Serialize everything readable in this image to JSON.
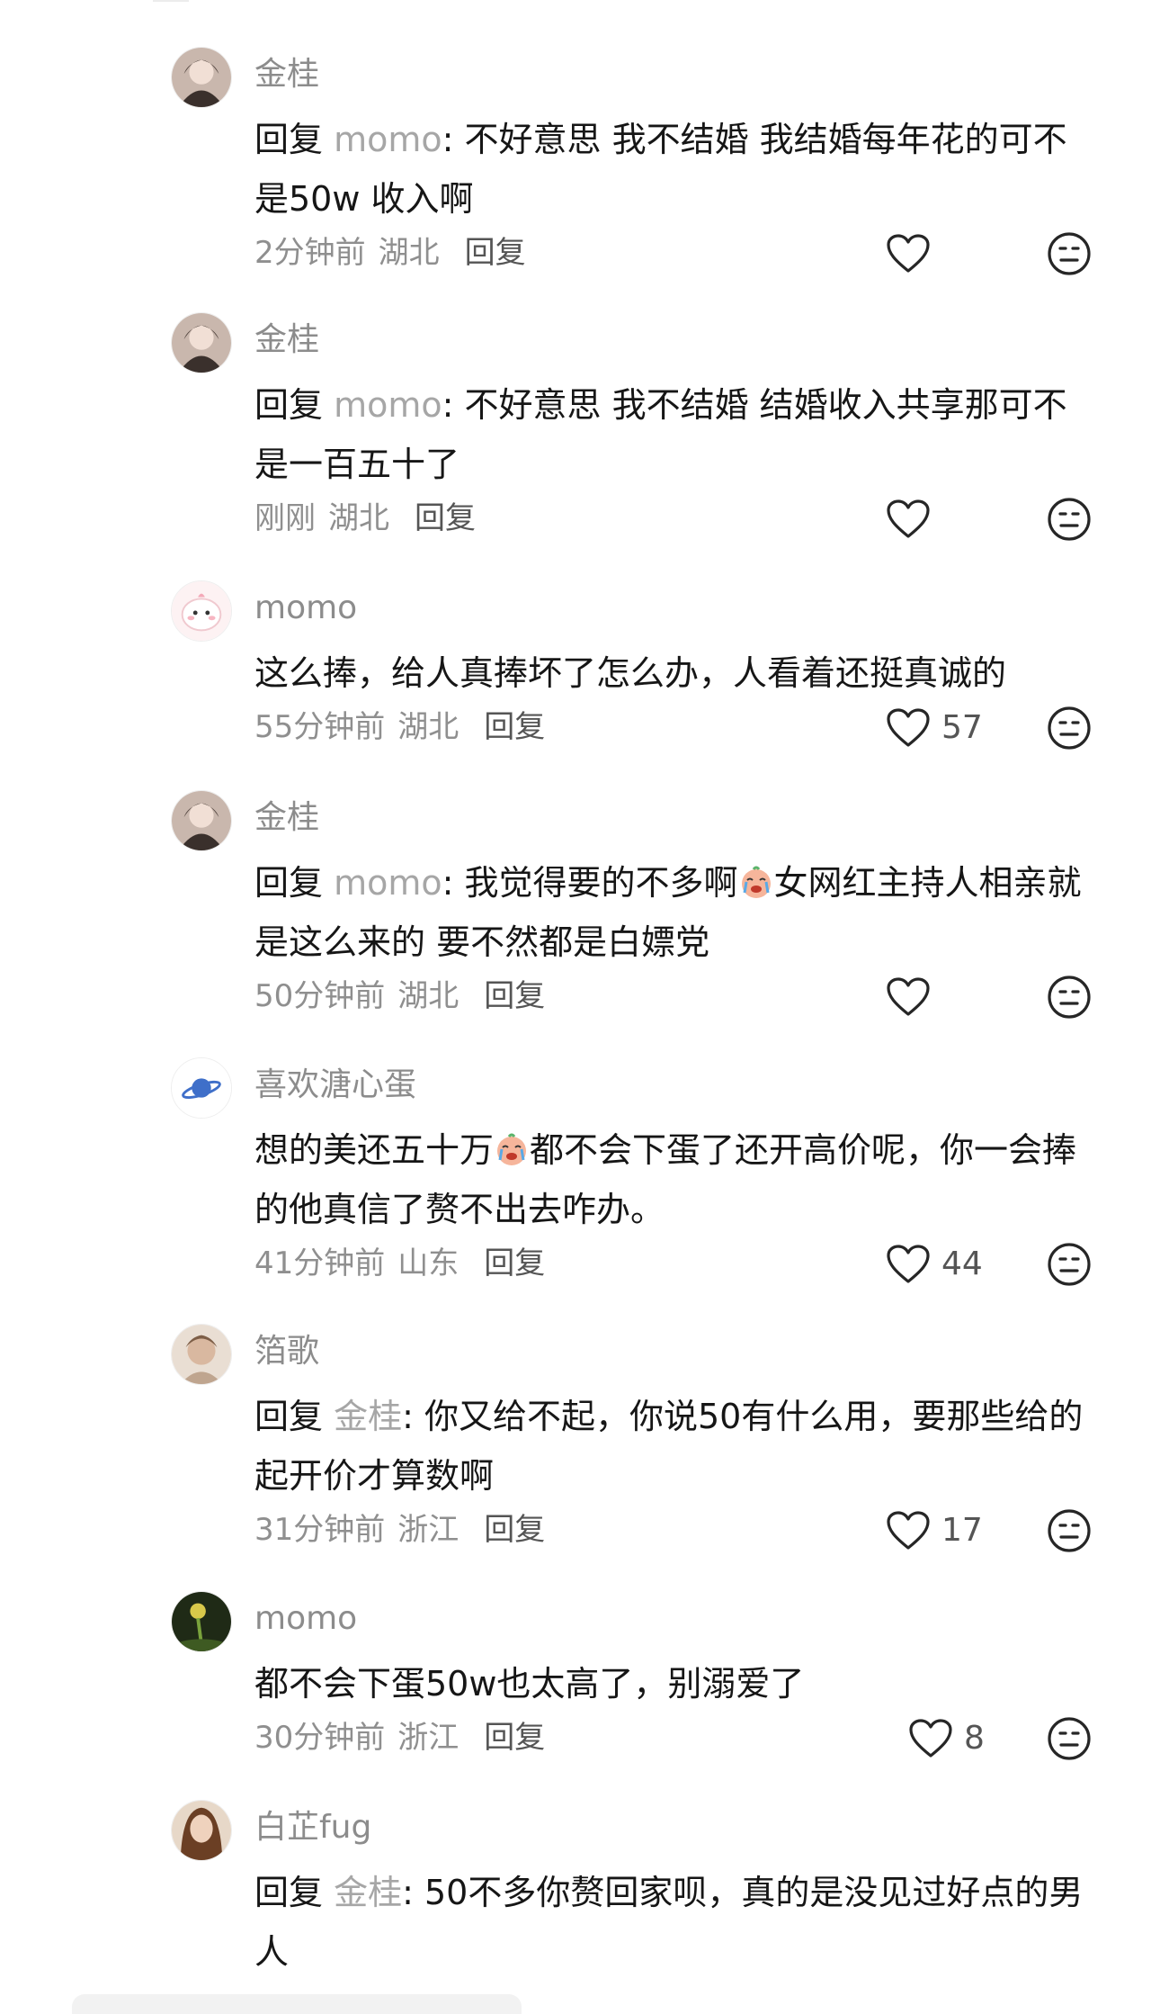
{
  "comments": [
    {
      "username": "金桂",
      "reply_prefix": "回复 ",
      "reply_target": "momo",
      "text": ": 不好意思 我不结婚 我结婚每年花的可不是50w 收入啊",
      "time": "2分钟前",
      "location": "湖北",
      "reply_label": "回复",
      "like_count": ""
    },
    {
      "username": "金桂",
      "reply_prefix": "回复 ",
      "reply_target": "momo",
      "text": ": 不好意思 我不结婚 结婚收入共享那可不是一百五十了",
      "time": "刚刚",
      "location": "湖北",
      "reply_label": "回复",
      "like_count": ""
    },
    {
      "username": "momo",
      "text": "这么捧，给人真捧坏了怎么办，人看着还挺真诚的",
      "time": "55分钟前",
      "location": "湖北",
      "reply_label": "回复",
      "like_count": "57"
    },
    {
      "username": "金桂",
      "reply_prefix": "回复 ",
      "reply_target": "momo",
      "text_before_emoji": ": 我觉得要的不多啊",
      "text_after_emoji": "女网红主持人相亲就是这么来的 要不然都是白嫖党",
      "time": "50分钟前",
      "location": "湖北",
      "reply_label": "回复",
      "like_count": ""
    },
    {
      "username": "喜欢溏心蛋",
      "text_before_emoji": "想的美还五十万",
      "text_after_emoji": "都不会下蛋了还开高价呢，你一会捧的他真信了赘不出去咋办。",
      "time": "41分钟前",
      "location": "山东",
      "reply_label": "回复",
      "like_count": "44"
    },
    {
      "username": "箔歌",
      "reply_prefix": "回复 ",
      "reply_target": "金桂",
      "text": ": 你又给不起，你说50有什么用，要那些给的起开价才算数啊",
      "time": "31分钟前",
      "location": "浙江",
      "reply_label": "回复",
      "like_count": "17"
    },
    {
      "username": "momo",
      "text": "都不会下蛋50w也太高了，别溺爱了",
      "time": "30分钟前",
      "location": "浙江",
      "reply_label": "回复",
      "like_count": "8"
    },
    {
      "username": "白芷fug",
      "reply_prefix": "回复 ",
      "reply_target": "金桂",
      "text": ": 50不多你赘回家呗，真的是没见过好点的男人"
    }
  ],
  "icons": {
    "like": "heart-outline-icon",
    "dislike": "meh-face-icon",
    "emoji": "crying-face-emoji"
  },
  "colors": {
    "username": "#8c8c8c",
    "reply_target": "#a6a6a6",
    "text": "#161616",
    "meta": "#8f8f8f"
  }
}
